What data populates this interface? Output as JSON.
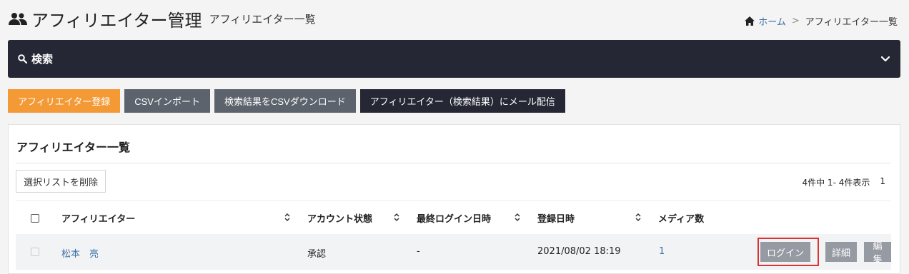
{
  "header": {
    "title": "アフィリエイター管理",
    "subtitle": "アフィリエイター一覧",
    "title_icon": "people-icon"
  },
  "breadcrumb": {
    "home": "ホーム",
    "separator": ">",
    "current": "アフィリエイター一覧"
  },
  "search": {
    "label": "検索",
    "icon": "search-icon",
    "toggle_icon": "chevron-down-icon"
  },
  "actions": {
    "register": "アフィリエイター登録",
    "csv_import": "CSVインポート",
    "csv_download": "検索結果をCSVダウンロード",
    "mail": "アフィリエイター（検索結果）にメール配信"
  },
  "list": {
    "title": "アフィリエイター一覧",
    "delete_selected": "選択リストを削除",
    "count_text": "4件中 1- 4件表示",
    "page": "1",
    "columns": [
      "アフィリエイター",
      "アカウント状態",
      "最終ログイン日時",
      "登録日時",
      "メディア数"
    ],
    "rows": [
      {
        "name": "松本　亮",
        "status": "承認",
        "last_login": "-",
        "registered": "2021/08/02 18:19",
        "media_count": "1",
        "login_label": "ログイン",
        "detail_label": "詳細",
        "edit_label": "編集"
      }
    ]
  },
  "colors": {
    "dark": "#262734",
    "orange": "#f39a36",
    "gray": "#5d636c",
    "link": "#3b6ea5",
    "highlight": "#e03131"
  }
}
